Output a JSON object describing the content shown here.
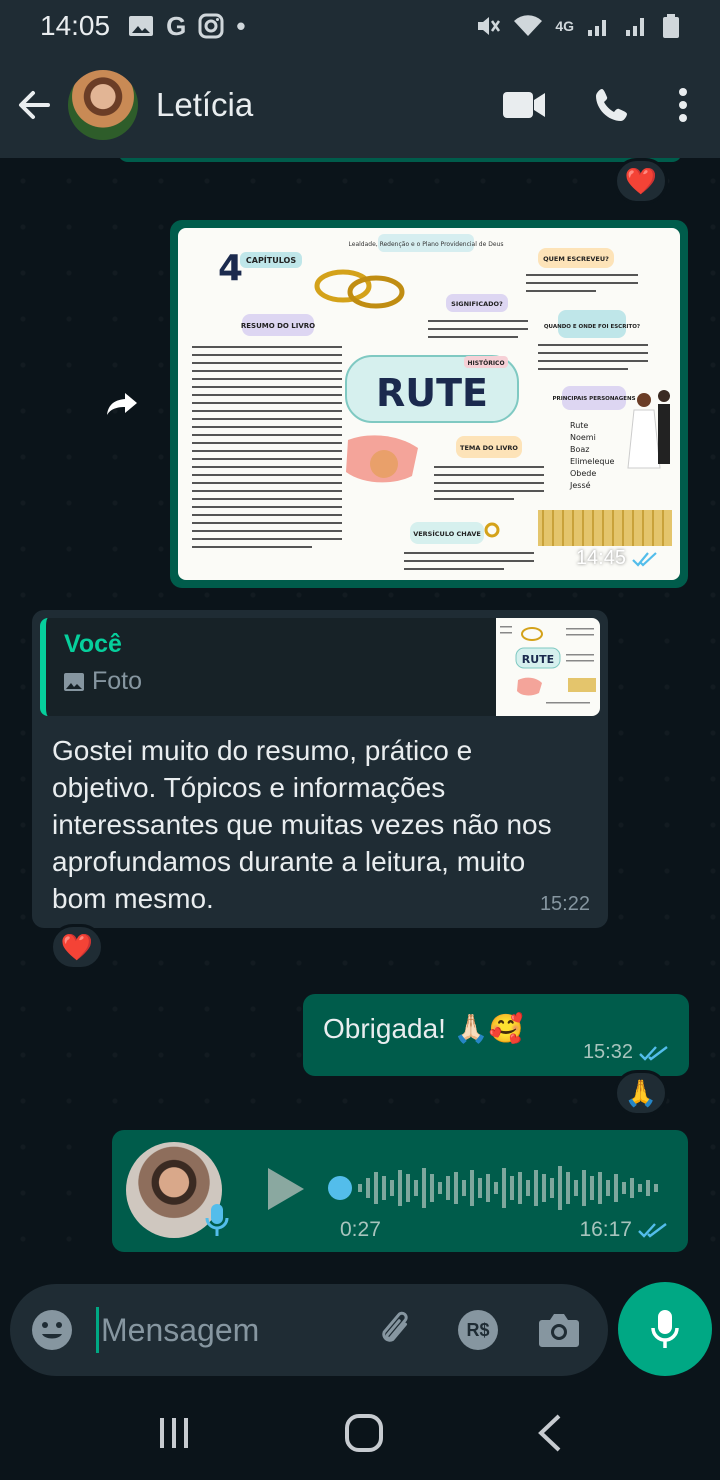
{
  "status_bar": {
    "time": "14:05",
    "left_icons": [
      "gallery-icon",
      "google-icon",
      "instagram-icon",
      "dot-icon"
    ],
    "network": "4G"
  },
  "header": {
    "contact_name": "Letícia"
  },
  "image_message": {
    "time": "14:45",
    "status": "read",
    "image_texts": {
      "top_caption": "Lealdade, Redenção e o Plano Providencial de Deus",
      "chapters_number": "4",
      "chapters_label": "CAPÍTULOS",
      "summary_label": "RESUMO DO LIVRO",
      "title": "RUTE",
      "historico": "HISTÓRICO",
      "who_wrote": "QUEM ESCREVEU?",
      "meaning": "SIGNIFICADO?",
      "when_where": "QUANDO E ONDE FOI ESCRITO?",
      "characters_label": "PRINCIPAIS PERSONAGENS",
      "characters": [
        "Rute",
        "Noemi",
        "Boaz",
        "Elimeleque",
        "Obede",
        "Jessé"
      ],
      "theme": "TEMA DO LIVRO",
      "key_verse": "VERSÍCULO CHAVE"
    }
  },
  "reply_message": {
    "quote_author": "Você",
    "quote_type": "Foto",
    "quote_thumb_title": "RUTE",
    "text": "Gostei muito do resumo, prático e objetivo. Tópicos  e informações interessantes que muitas vezes não nos aprofundamos durante a leitura, muito bom mesmo.",
    "time": "15:22",
    "reaction": "❤️"
  },
  "first_reaction": "❤️",
  "thanks_message": {
    "text": "Obrigada! 🙏🏻🥰",
    "time": "15:32",
    "status": "read",
    "reaction": "🙏"
  },
  "audio_message": {
    "duration": "0:27",
    "time": "16:17",
    "status": "read"
  },
  "composer": {
    "placeholder": "Mensagem",
    "currency_label": "R$"
  },
  "colors": {
    "accent": "#00a884",
    "outgoing": "#005c4b",
    "incoming": "#1f2c34",
    "background": "#0b141a",
    "read_ticks": "#53bdeb"
  }
}
